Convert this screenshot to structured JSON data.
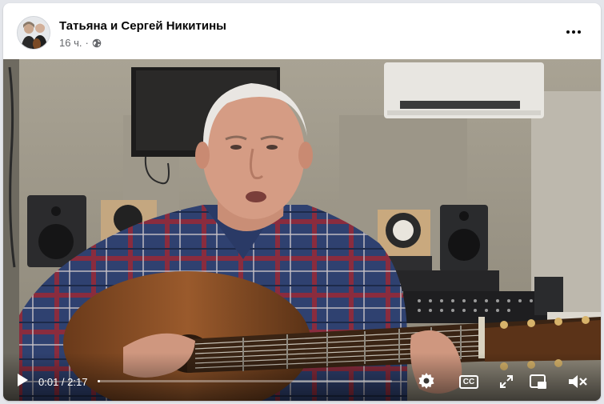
{
  "post": {
    "author": "Татьяна и Сергей Никитины",
    "time": "16 ч.",
    "separator": "·",
    "privacy_icon": "globe-icon",
    "more_icon": "more-options-icon"
  },
  "player": {
    "current_time": "0:01",
    "separator": " / ",
    "duration": "2:17",
    "progress": 0.007,
    "icons": [
      "play-icon",
      "settings-icon",
      "captions-icon",
      "fullscreen-icon",
      "picture-in-picture-icon",
      "volume-muted-icon"
    ],
    "captions_label": "CC"
  },
  "colors": {
    "author": "#050505",
    "meta": "#65676b",
    "shirt_blue": "#2d3f6e",
    "shirt_red": "#a8283a"
  }
}
